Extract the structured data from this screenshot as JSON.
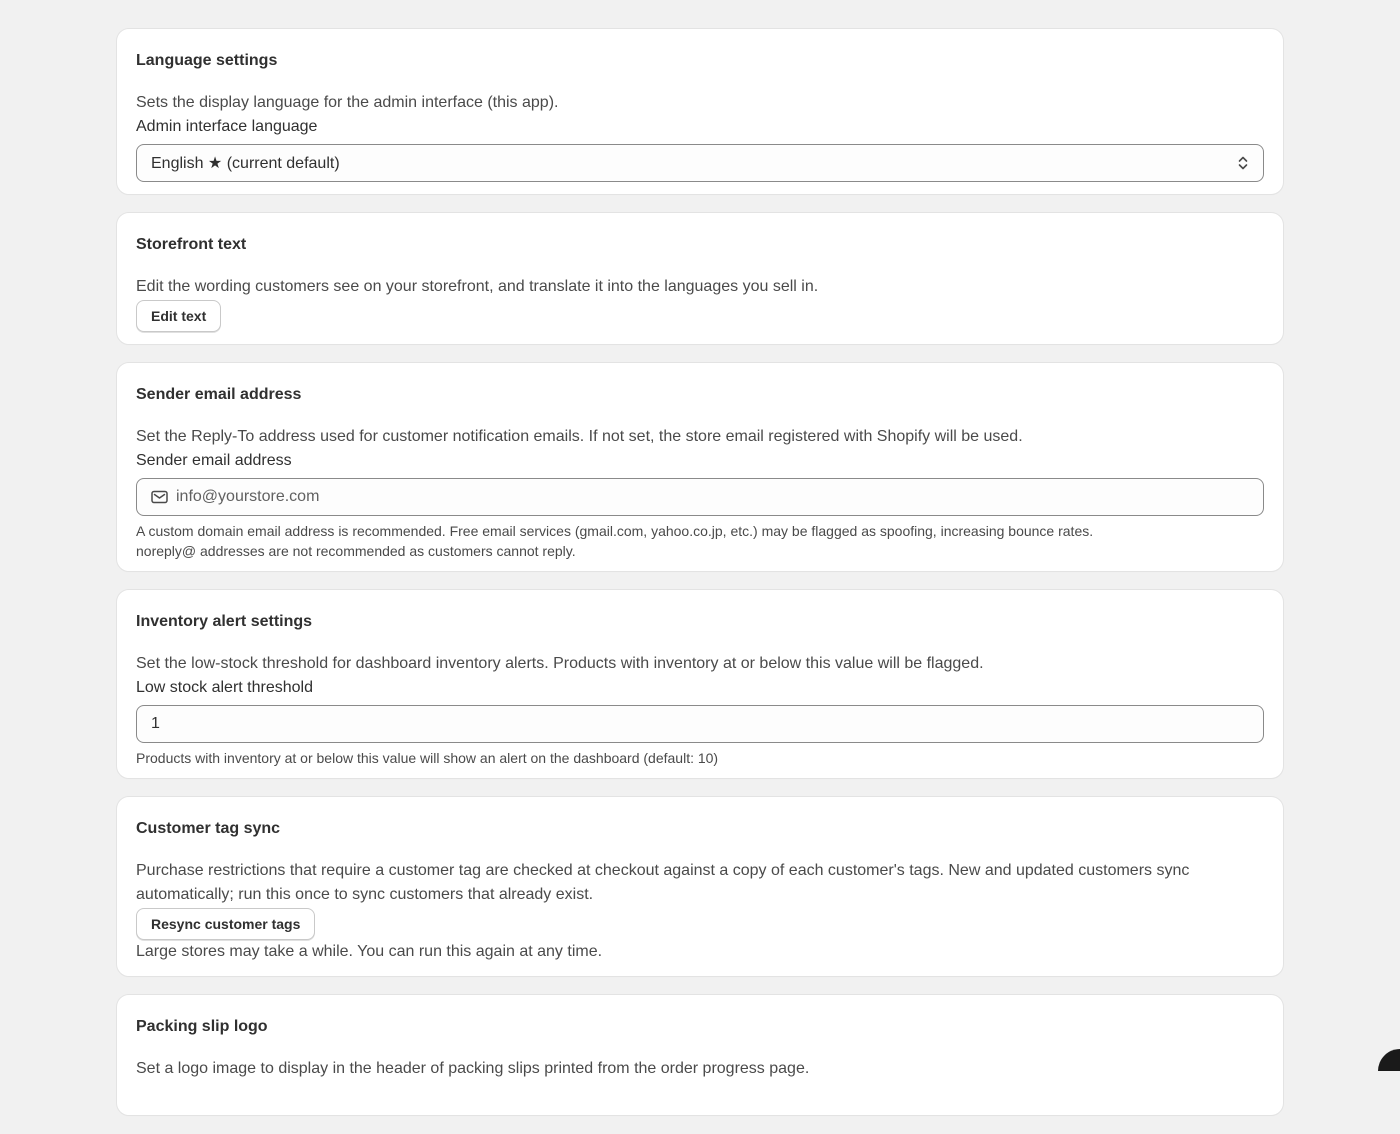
{
  "language": {
    "title": "Language settings",
    "description": "Sets the display language for the admin interface (this app).",
    "field_label": "Admin interface language",
    "selected": "English ★ (current default)"
  },
  "storefront": {
    "title": "Storefront text",
    "description": "Edit the wording customers see on your storefront, and translate it into the languages you sell in.",
    "button": "Edit text"
  },
  "sender_email": {
    "title": "Sender email address",
    "description": "Set the Reply-To address used for customer notification emails. If not set, the store email registered with Shopify will be used.",
    "field_label": "Sender email address",
    "placeholder": "info@yourstore.com",
    "help_line1": "A custom domain email address is recommended. Free email services (gmail.com, yahoo.co.jp, etc.) may be flagged as spoofing, increasing bounce rates.",
    "help_line2": "noreply@ addresses are not recommended as customers cannot reply."
  },
  "inventory": {
    "title": "Inventory alert settings",
    "description": "Set the low-stock threshold for dashboard inventory alerts. Products with inventory at or below this value will be flagged.",
    "field_label": "Low stock alert threshold",
    "value": "1",
    "help": "Products with inventory at or below this value will show an alert on the dashboard (default: 10)"
  },
  "tag_sync": {
    "title": "Customer tag sync",
    "description": "Purchase restrictions that require a customer tag are checked at checkout against a copy of each customer's tags. New and updated customers sync automatically; run this once to sync customers that already exist.",
    "button": "Resync customer tags",
    "note": "Large stores may take a while. You can run this again at any time."
  },
  "packing_slip": {
    "title": "Packing slip logo",
    "description": "Set a logo image to display in the header of packing slips printed from the order progress page."
  }
}
